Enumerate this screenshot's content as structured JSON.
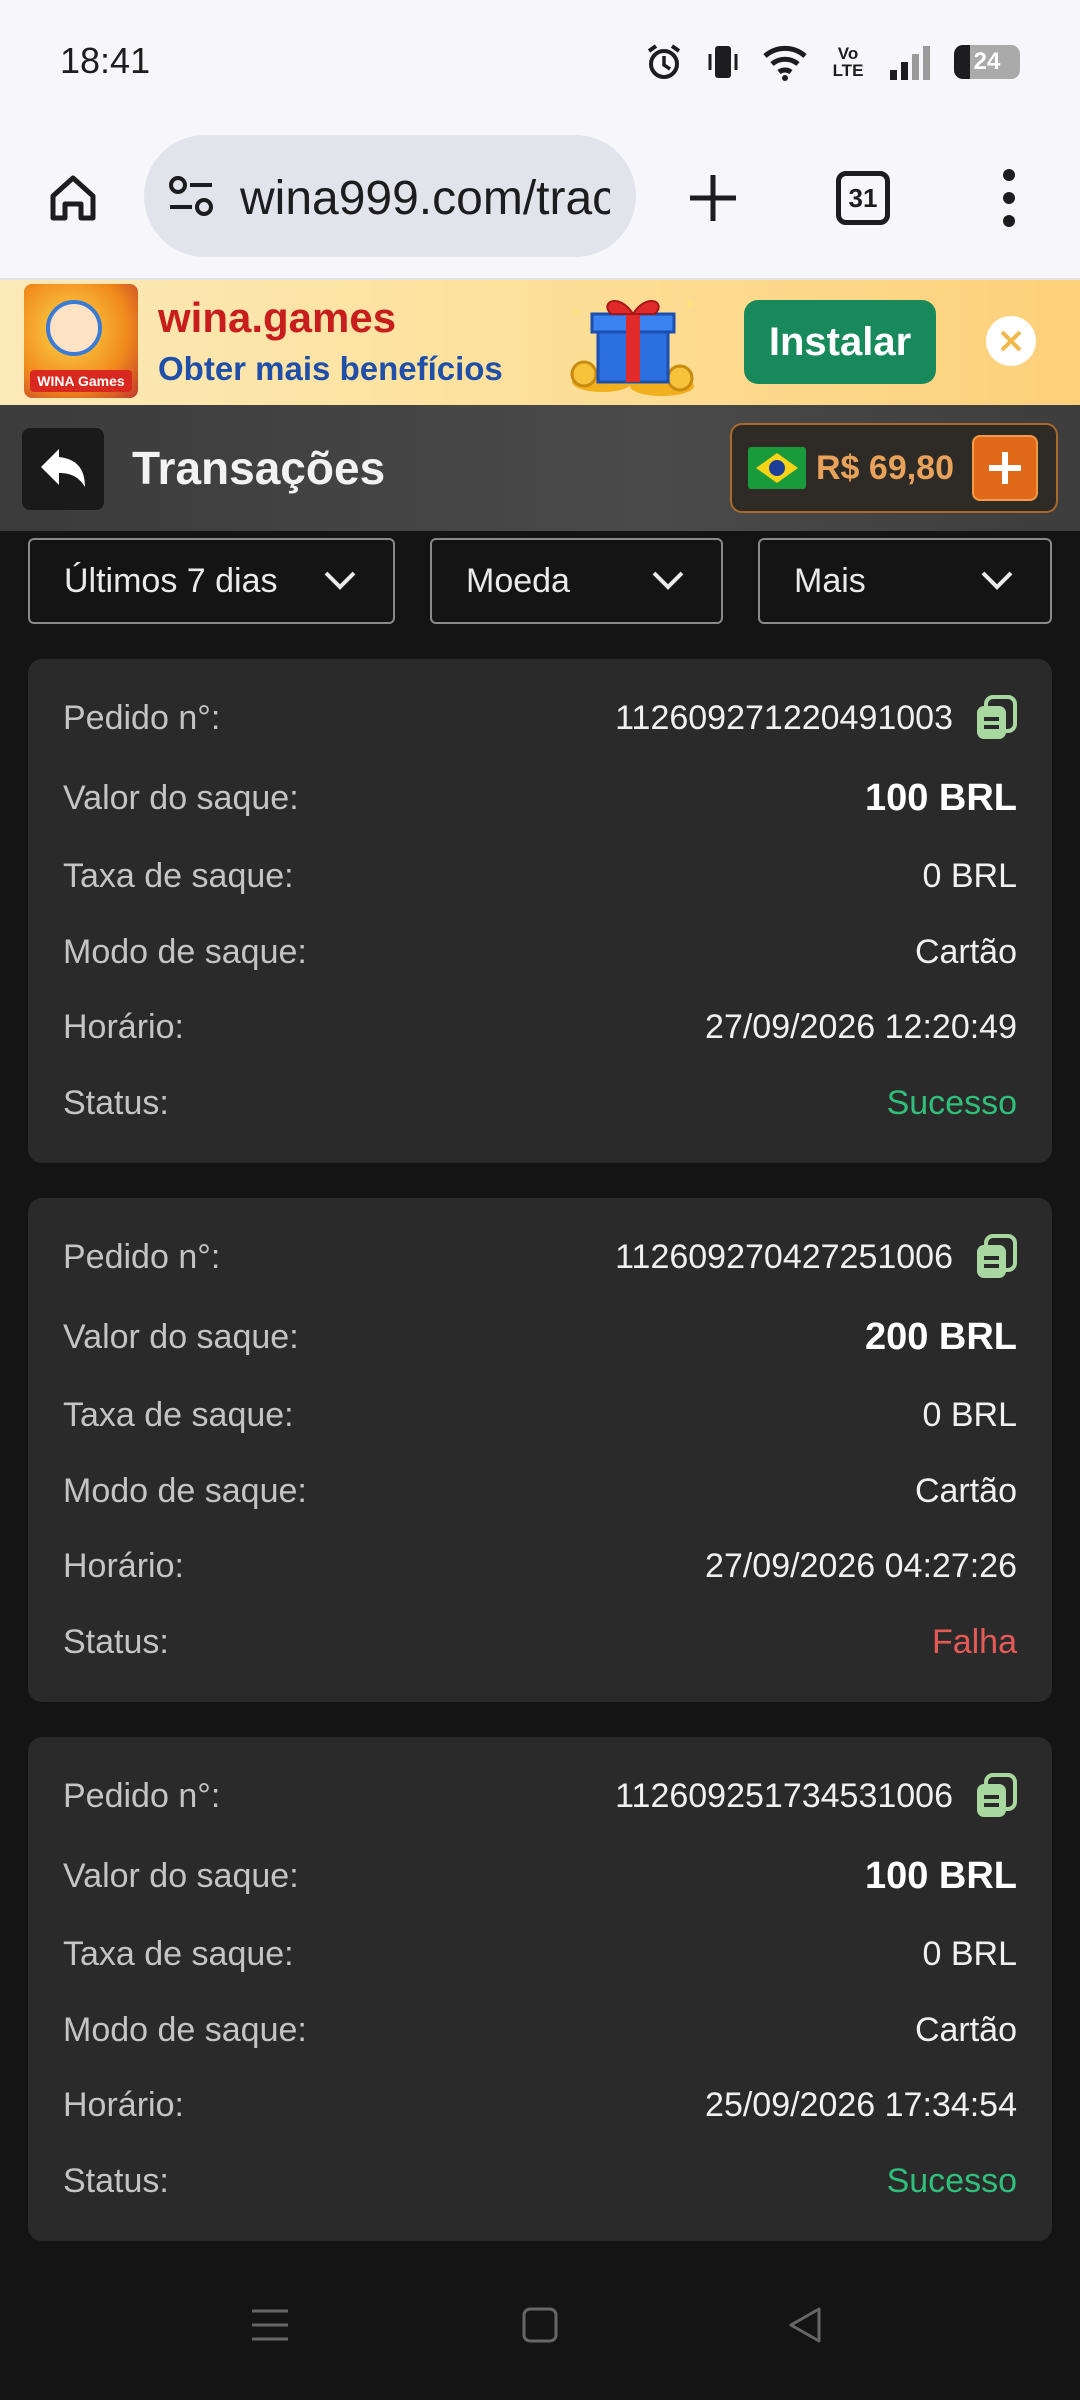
{
  "status_bar": {
    "time": "18:41",
    "network_label": "Vo LTE",
    "battery_level": "24",
    "battery_fraction": 0.24
  },
  "browser": {
    "url": "wina999.com/trac",
    "tab_count": "31"
  },
  "banner": {
    "logo_text": "WINA Games",
    "title": "wina.games",
    "subtitle": "Obter mais benefícios",
    "install_label": "Instalar"
  },
  "header": {
    "title": "Transações",
    "balance": "R$ 69,80"
  },
  "filters": {
    "period": "Últimos 7 dias",
    "currency": "Moeda",
    "more": "Mais"
  },
  "labels": {
    "order": "Pedido n°:",
    "amount": "Valor do saque:",
    "fee": "Taxa de saque:",
    "mode": "Modo de saque:",
    "time": "Horário:",
    "status": "Status:"
  },
  "transactions": [
    {
      "order_id": "112609271220491003",
      "amount": "100 BRL",
      "fee": "0 BRL",
      "mode": "Cartão",
      "time": "27/09/2026 12:20:49",
      "status": "Sucesso"
    },
    {
      "order_id": "112609270427251006",
      "amount": "200 BRL",
      "fee": "0 BRL",
      "mode": "Cartão",
      "time": "27/09/2026 04:27:26",
      "status": "Falha"
    },
    {
      "order_id": "112609251734531006",
      "amount": "100 BRL",
      "fee": "0 BRL",
      "mode": "Cartão",
      "time": "25/09/2026 17:34:54",
      "status": "Sucesso"
    }
  ],
  "colors": {
    "success": "#2fbf7a",
    "failure": "#e65a55",
    "install_button": "#17895a",
    "balance": "#e8a25a",
    "copy_icon": "#a8d8a0"
  }
}
